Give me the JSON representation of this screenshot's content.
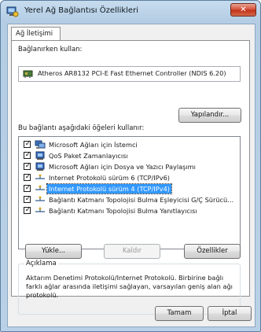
{
  "window": {
    "title": "Yerel Ağ Bağlantısı Özellikleri",
    "close_label": "✕",
    "title_icon": "network-properties-icon"
  },
  "tabs": [
    {
      "label": "Ağ İletişimi",
      "active": true
    }
  ],
  "connect_using": {
    "label": "Bağlanırken kullan:",
    "adapter_name": "Atheros AR8132 PCI-E Fast Ethernet Controller (NDIS 6.20)",
    "adapter_icon": "network-adapter-icon",
    "configure_button": "Yapılandır..."
  },
  "items_section": {
    "label": "Bu bağlantı aşağıdaki öğeleri kullanır:",
    "items": [
      {
        "label": "Microsoft Ağları için İstemci",
        "checked": true,
        "icon": "client-icon"
      },
      {
        "label": "QoS Paket Zamanlayıcısı",
        "checked": true,
        "icon": "service-icon"
      },
      {
        "label": "Microsoft Ağları için Dosya ve Yazıcı Paylaşımı",
        "checked": true,
        "icon": "service-icon"
      },
      {
        "label": "Internet Protokolü sürüm 6 (TCP/IPv6)",
        "checked": true,
        "icon": "protocol-icon"
      },
      {
        "label": "Internet Protokolü sürüm 4 (TCP/IPv4)",
        "checked": true,
        "icon": "protocol-icon",
        "selected": true
      },
      {
        "label": "Bağlantı Katmanı Topolojisi Bulma Eşleyicisi G/Ç Sürücü...",
        "checked": true,
        "icon": "protocol-icon"
      },
      {
        "label": "Bağlantı Katmanı Topolojisi Bulma Yanıtlayıcısı",
        "checked": true,
        "icon": "protocol-icon"
      }
    ],
    "check_mark": "✓"
  },
  "actions": {
    "install": "Yükle...",
    "uninstall": "Kaldır",
    "properties": "Özellikler"
  },
  "description": {
    "title": "Açıklama",
    "text": "Aktarım Denetimi Protokolü/Internet Protokolü. Birbirine bağlı farklı ağlar arasında iletişimi sağlayan, varsayılan geniş alan ağı protokolü."
  },
  "footer": {
    "ok": "Tamam",
    "cancel": "İptal"
  },
  "colors": {
    "selection": "#3399ff",
    "title_gradient_top": "#c7dcee",
    "close_red": "#c2331a"
  }
}
